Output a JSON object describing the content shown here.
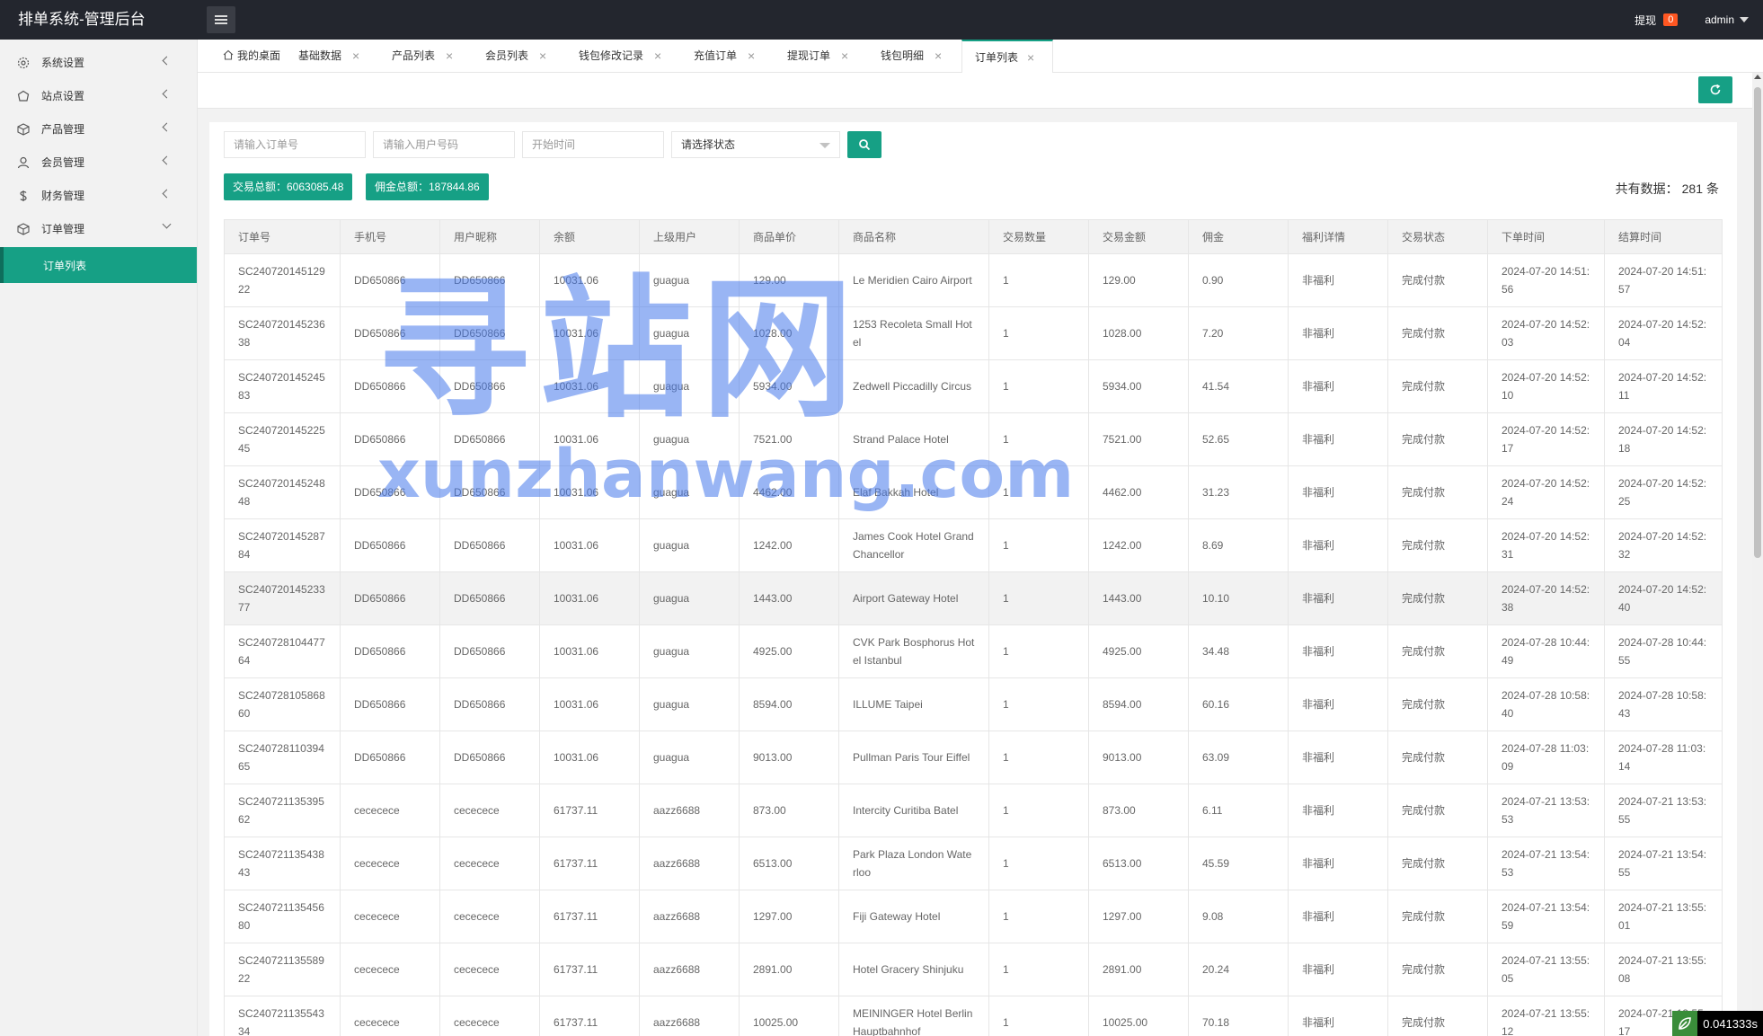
{
  "app": {
    "title": "排单系统-管理后台"
  },
  "header": {
    "withdraw_label": "提现",
    "withdraw_badge": "0",
    "user": "admin"
  },
  "sidebar": {
    "items": [
      {
        "label": "系统设置",
        "icon": "gear-icon"
      },
      {
        "label": "站点设置",
        "icon": "site-icon"
      },
      {
        "label": "产品管理",
        "icon": "box-icon"
      },
      {
        "label": "会员管理",
        "icon": "user-icon"
      },
      {
        "label": "财务管理",
        "icon": "dollar-icon"
      },
      {
        "label": "订单管理",
        "icon": "box-icon"
      }
    ],
    "sub_item": "订单列表"
  },
  "tabs": [
    "我的桌面",
    "基础数据",
    "产品列表",
    "会员列表",
    "钱包修改记录",
    "充值订单",
    "提现订单",
    "钱包明细",
    "订单列表"
  ],
  "filters": {
    "order_no_placeholder": "请输入订单号",
    "user_no_placeholder": "请输入用户号码",
    "start_time_placeholder": "开始时间",
    "status_select": "请选择状态"
  },
  "stats": {
    "trade_total": "交易总额：6063085.48",
    "commission_total": "佣金总额：187844.86",
    "total_prefix": "共有数据：",
    "total_count": "281",
    "total_suffix": "条"
  },
  "table": {
    "headers": [
      "订单号",
      "手机号",
      "用户昵称",
      "余额",
      "上级用户",
      "商品单价",
      "商品名称",
      "交易数量",
      "交易金额",
      "佣金",
      "福利详情",
      "交易状态",
      "下单时间",
      "结算时间"
    ],
    "rows": [
      [
        "SC24072014512922",
        "DD650866",
        "DD650866",
        "10031.06",
        "guagua",
        "129.00",
        "Le Meridien Cairo Airport",
        "1",
        "129.00",
        "0.90",
        "非福利",
        "完成付款",
        "2024-07-20 14:51:56",
        "2024-07-20 14:51:57"
      ],
      [
        "SC24072014523638",
        "DD650866",
        "DD650866",
        "10031.06",
        "guagua",
        "1028.00",
        "1253 Recoleta Small Hotel",
        "1",
        "1028.00",
        "7.20",
        "非福利",
        "完成付款",
        "2024-07-20 14:52:03",
        "2024-07-20 14:52:04"
      ],
      [
        "SC24072014524583",
        "DD650866",
        "DD650866",
        "10031.06",
        "guagua",
        "5934.00",
        "Zedwell Piccadilly Circus",
        "1",
        "5934.00",
        "41.54",
        "非福利",
        "完成付款",
        "2024-07-20 14:52:10",
        "2024-07-20 14:52:11"
      ],
      [
        "SC24072014522545",
        "DD650866",
        "DD650866",
        "10031.06",
        "guagua",
        "7521.00",
        "Strand Palace Hotel",
        "1",
        "7521.00",
        "52.65",
        "非福利",
        "完成付款",
        "2024-07-20 14:52:17",
        "2024-07-20 14:52:18"
      ],
      [
        "SC24072014524848",
        "DD650866",
        "DD650866",
        "10031.06",
        "guagua",
        "4462.00",
        "Elaf Bakkah Hotel",
        "1",
        "4462.00",
        "31.23",
        "非福利",
        "完成付款",
        "2024-07-20 14:52:24",
        "2024-07-20 14:52:25"
      ],
      [
        "SC24072014528784",
        "DD650866",
        "DD650866",
        "10031.06",
        "guagua",
        "1242.00",
        "James Cook Hotel Grand Chancellor",
        "1",
        "1242.00",
        "8.69",
        "非福利",
        "完成付款",
        "2024-07-20 14:52:31",
        "2024-07-20 14:52:32"
      ],
      [
        "SC24072014523377",
        "DD650866",
        "DD650866",
        "10031.06",
        "guagua",
        "1443.00",
        "Airport Gateway Hotel",
        "1",
        "1443.00",
        "10.10",
        "非福利",
        "完成付款",
        "2024-07-20 14:52:38",
        "2024-07-20 14:52:40"
      ],
      [
        "SC24072810447764",
        "DD650866",
        "DD650866",
        "10031.06",
        "guagua",
        "4925.00",
        "CVK Park Bosphorus Hotel Istanbul",
        "1",
        "4925.00",
        "34.48",
        "非福利",
        "完成付款",
        "2024-07-28 10:44:49",
        "2024-07-28 10:44:55"
      ],
      [
        "SC24072810586860",
        "DD650866",
        "DD650866",
        "10031.06",
        "guagua",
        "8594.00",
        "ILLUME Taipei",
        "1",
        "8594.00",
        "60.16",
        "非福利",
        "完成付款",
        "2024-07-28 10:58:40",
        "2024-07-28 10:58:43"
      ],
      [
        "SC24072811039465",
        "DD650866",
        "DD650866",
        "10031.06",
        "guagua",
        "9013.00",
        "Pullman Paris Tour Eiffel",
        "1",
        "9013.00",
        "63.09",
        "非福利",
        "完成付款",
        "2024-07-28 11:03:09",
        "2024-07-28 11:03:14"
      ],
      [
        "SC24072113539562",
        "cececece",
        "cececece",
        "61737.11",
        "aazz6688",
        "873.00",
        "Intercity Curitiba Batel",
        "1",
        "873.00",
        "6.11",
        "非福利",
        "完成付款",
        "2024-07-21 13:53:53",
        "2024-07-21 13:53:55"
      ],
      [
        "SC24072113543843",
        "cececece",
        "cececece",
        "61737.11",
        "aazz6688",
        "6513.00",
        "Park Plaza London Waterloo",
        "1",
        "6513.00",
        "45.59",
        "非福利",
        "完成付款",
        "2024-07-21 13:54:53",
        "2024-07-21 13:54:55"
      ],
      [
        "SC24072113545680",
        "cececece",
        "cececece",
        "61737.11",
        "aazz6688",
        "1297.00",
        "Fiji Gateway Hotel",
        "1",
        "1297.00",
        "9.08",
        "非福利",
        "完成付款",
        "2024-07-21 13:54:59",
        "2024-07-21 13:55:01"
      ],
      [
        "SC24072113558922",
        "cececece",
        "cececece",
        "61737.11",
        "aazz6688",
        "2891.00",
        "Hotel Gracery Shinjuku",
        "1",
        "2891.00",
        "20.24",
        "非福利",
        "完成付款",
        "2024-07-21 13:55:05",
        "2024-07-21 13:55:08"
      ],
      [
        "SC24072113554334",
        "cececece",
        "cececece",
        "61737.11",
        "aazz6688",
        "10025.00",
        "MEININGER Hotel Berlin Hauptbahnhof",
        "1",
        "10025.00",
        "70.18",
        "非福利",
        "完成付款",
        "2024-07-21 13:55:12",
        "2024-07-21 13:55:17"
      ]
    ]
  },
  "watermark": {
    "cn": "寻站网",
    "en": "xunzhanwang.com"
  },
  "timer": {
    "value": "0.041333s"
  },
  "colors": {
    "accent": "#16a085",
    "topbar": "#23262e",
    "badge": "#ff5722"
  }
}
